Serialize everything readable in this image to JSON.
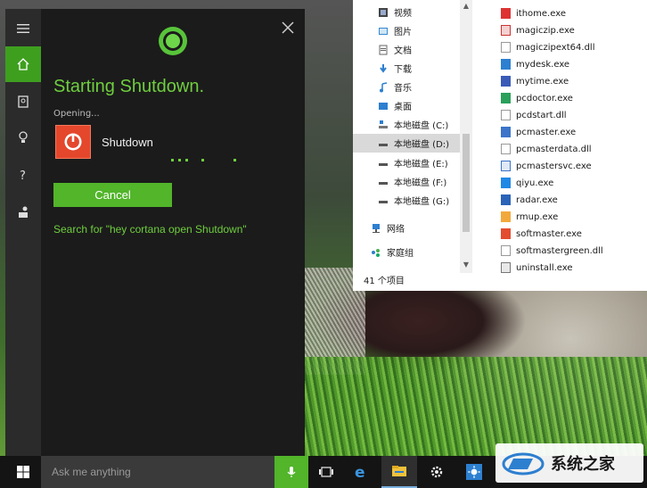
{
  "cortana": {
    "heading": "Starting Shutdown.",
    "opening_label": "Opening...",
    "app_name": "Shutdown",
    "cancel_label": "Cancel",
    "search_suggestion": "Search for \"hey cortana open Shutdown\"",
    "accent_color": "#6fce3f",
    "rail_icons": [
      "hamburger-menu-icon",
      "home-icon",
      "notebook-icon",
      "lightbulb-icon",
      "help-icon",
      "feedback-icon"
    ]
  },
  "explorer": {
    "nav_items": [
      {
        "label": "视频",
        "icon": "video-folder-icon"
      },
      {
        "label": "图片",
        "icon": "pictures-folder-icon"
      },
      {
        "label": "文档",
        "icon": "documents-folder-icon"
      },
      {
        "label": "下载",
        "icon": "downloads-folder-icon"
      },
      {
        "label": "音乐",
        "icon": "music-folder-icon"
      },
      {
        "label": "桌面",
        "icon": "desktop-folder-icon"
      },
      {
        "label": "本地磁盘 (C:)",
        "icon": "windows-drive-icon"
      },
      {
        "label": "本地磁盘 (D:)",
        "icon": "drive-icon"
      },
      {
        "label": "本地磁盘 (E:)",
        "icon": "drive-icon"
      },
      {
        "label": "本地磁盘 (F:)",
        "icon": "drive-icon"
      },
      {
        "label": "本地磁盘 (G:)",
        "icon": "drive-icon"
      },
      {
        "label": "网络",
        "icon": "network-icon"
      },
      {
        "label": "家庭组",
        "icon": "homegroup-icon"
      }
    ],
    "selected_nav": "本地磁盘 (D:)",
    "files": [
      {
        "name": "ithome.exe",
        "icon": "ithome-app-icon"
      },
      {
        "name": "magiczip.exe",
        "icon": "magiczip-app-icon"
      },
      {
        "name": "magiczipext64.dll",
        "icon": "dll-file-icon"
      },
      {
        "name": "mydesk.exe",
        "icon": "mydesk-app-icon"
      },
      {
        "name": "mytime.exe",
        "icon": "mytime-app-icon"
      },
      {
        "name": "pcdoctor.exe",
        "icon": "pcdoctor-app-icon"
      },
      {
        "name": "pcdstart.dll",
        "icon": "dll-file-icon"
      },
      {
        "name": "pcmaster.exe",
        "icon": "pcmaster-app-icon"
      },
      {
        "name": "pcmasterdata.dll",
        "icon": "dll-file-icon"
      },
      {
        "name": "pcmastersvc.exe",
        "icon": "pcmastersvc-app-icon"
      },
      {
        "name": "qiyu.exe",
        "icon": "qiyu-app-icon"
      },
      {
        "name": "radar.exe",
        "icon": "radar-app-icon"
      },
      {
        "name": "rmup.exe",
        "icon": "rmup-app-icon"
      },
      {
        "name": "softmaster.exe",
        "icon": "softmaster-app-icon"
      },
      {
        "name": "softmastergreen.dll",
        "icon": "dll-file-icon"
      },
      {
        "name": "uninstall.exe",
        "icon": "uninstall-app-icon"
      }
    ],
    "status": "41 个项目"
  },
  "taskbar": {
    "search_placeholder": "Ask me anything",
    "apps": [
      "task-view-icon",
      "edge-icon",
      "file-explorer-icon",
      "settings-icon",
      "weather-app-icon"
    ]
  },
  "watermark": {
    "text": "系统之家"
  }
}
